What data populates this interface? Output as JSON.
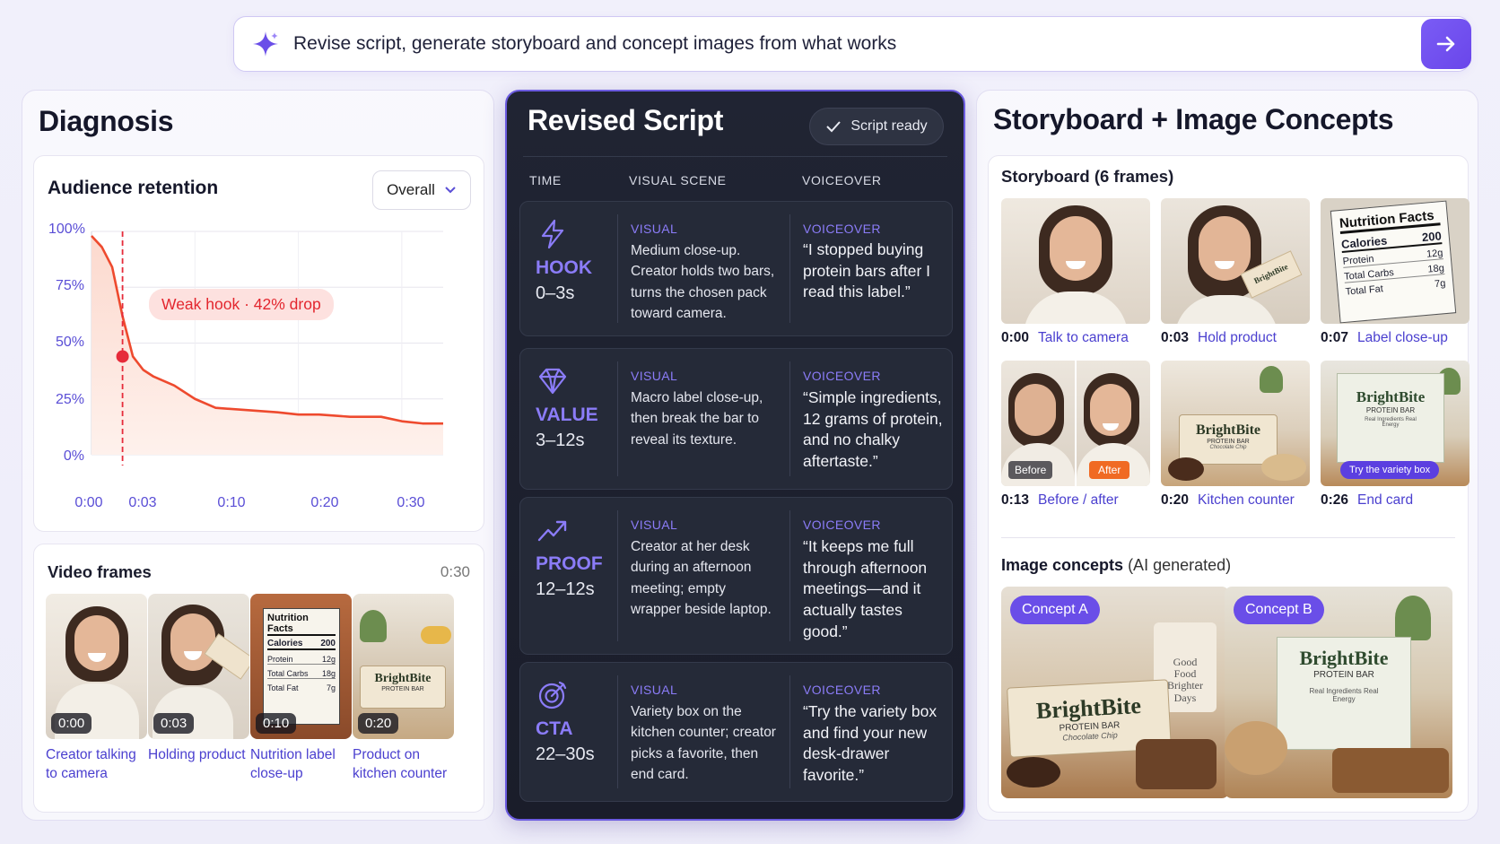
{
  "prompt": {
    "text": "Revise script, generate storyboard and concept images from what works",
    "icon": "sparkle-icon",
    "submit_icon": "arrow-right-icon"
  },
  "diagnosis": {
    "title": "Diagnosis",
    "retention": {
      "title": "Audience retention",
      "dropdown": "Overall",
      "annotation": "Weak hook · 42% drop"
    },
    "frames": {
      "title": "Video frames",
      "duration": "0:30",
      "items": [
        {
          "time": "0:00",
          "caption": "Creator talking to camera"
        },
        {
          "time": "0:03",
          "caption": "Holding product"
        },
        {
          "time": "0:10",
          "caption": "Nutrition label close-up"
        },
        {
          "time": "0:20",
          "caption": "Product on kitchen counter"
        }
      ]
    }
  },
  "chart_data": {
    "type": "area",
    "title": "Audience retention",
    "x_ticks": [
      "0:00",
      "0:03",
      "0:10",
      "0:20",
      "0:30"
    ],
    "y_ticks": [
      "100%",
      "75%",
      "50%",
      "25%",
      "0%"
    ],
    "x": [
      0,
      1,
      2,
      3,
      4,
      5,
      6,
      8,
      10,
      12,
      15,
      18,
      20,
      22,
      25,
      28,
      30,
      32,
      34
    ],
    "values": [
      98,
      93,
      84,
      62,
      44,
      38,
      35,
      31,
      25,
      21,
      20,
      19,
      18,
      18,
      17,
      17,
      15,
      14,
      14
    ],
    "ylim": [
      0,
      100
    ],
    "xlim": [
      0,
      34
    ],
    "marker_x": 3,
    "marker_y": 44,
    "colors": {
      "line": "#ee4a2e",
      "fill": "#fde5de",
      "marker": "#e62b3a",
      "annotation_bg": "#fde1df",
      "annotation_text": "#e3262e"
    }
  },
  "script": {
    "title": "Revised Script",
    "status": "Script ready",
    "columns": {
      "time": "TIME",
      "visual": "VISUAL SCENE",
      "voiceover": "VOICEOVER"
    },
    "rows": [
      {
        "icon": "lightning-icon",
        "label": "HOOK",
        "time": "0–3s",
        "visual_label": "VISUAL",
        "visual": "Medium close-up. Creator holds two bars, turns the chosen pack toward camera.",
        "vo_label": "VOICEOVER",
        "voiceover": "“I stopped buying protein bars after I read this label.”"
      },
      {
        "icon": "diamond-icon",
        "label": "VALUE",
        "time": "3–12s",
        "visual_label": "VISUAL",
        "visual": "Macro label close-up, then break the bar to reveal its texture.",
        "vo_label": "VOICEOVER",
        "voiceover": "“Simple ingredients, 12 grams of protein, and no chalky aftertaste.”"
      },
      {
        "icon": "trending-up-icon",
        "label": "PROOF",
        "time": "12–12s",
        "visual_label": "VISUAL",
        "visual": "Creator at her desk during an afternoon meeting; empty wrapper beside laptop.",
        "vo_label": "VOICEOVER",
        "voiceover": "“It keeps me full through afternoon meetings—and it actually tastes good.”"
      },
      {
        "icon": "target-icon",
        "label": "CTA",
        "time": "22–30s",
        "visual_label": "VISUAL",
        "visual": "Variety box on the kitchen counter; creator picks a favorite, then end card.",
        "vo_label": "VOICEOVER",
        "voiceover": "“Try the variety box and find your new desk-drawer favorite.”"
      }
    ]
  },
  "storyboard": {
    "title": "Storyboard + Image Concepts",
    "section": "Storyboard (6 frames)",
    "frames": [
      {
        "time": "0:00",
        "caption": "Talk to camera"
      },
      {
        "time": "0:03",
        "caption": "Hold product"
      },
      {
        "time": "0:07",
        "caption": "Label close-up"
      },
      {
        "time": "0:13",
        "caption": "Before / after"
      },
      {
        "time": "0:20",
        "caption": "Kitchen counter"
      },
      {
        "time": "0:26",
        "caption": "End card"
      }
    ],
    "concepts_title": "Image concepts",
    "concepts_note": "(AI generated)",
    "concepts": [
      {
        "label": "Concept A"
      },
      {
        "label": "Concept B"
      }
    ],
    "overlays": {
      "before": "Before",
      "after": "After",
      "end_card_cta": "Try the variety box",
      "nutrition_title": "Nutrition Facts",
      "calories_label": "Calories",
      "calories_value": "200",
      "protein_label": "Protein",
      "protein_value": "12g",
      "carbs_label": "Total Carbs",
      "carbs_value": "18g",
      "fat_label": "Total Fat",
      "fat_value": "7g"
    }
  },
  "brand": {
    "name": "BrightBite",
    "product": "PROTEIN BAR",
    "flavor": "Chocolate Chip",
    "box_tagline": "Real Ingredients Real Energy",
    "mug_text": "Good Food Brighter Days"
  },
  "colors": {
    "accent": "#6a4ee8",
    "accent_text": "#4a3fcf",
    "dark_panel": "#1e2230"
  }
}
